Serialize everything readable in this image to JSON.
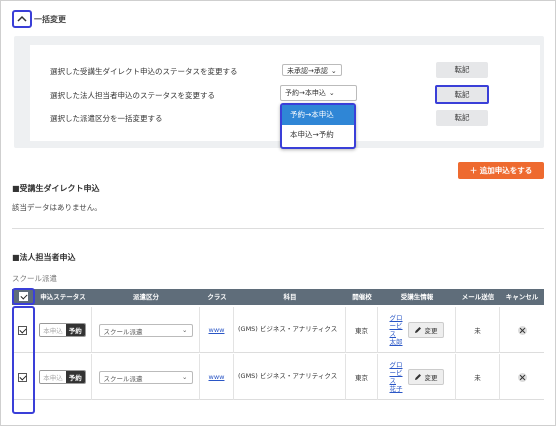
{
  "bulk": {
    "title": "一括変更",
    "rows": [
      {
        "label": "選択した受講生ダイレクト申込のステータスを変更する",
        "select_value": "未承認→承認",
        "button": "転記"
      },
      {
        "label": "選択した法人担当者申込のステータスを変更する",
        "select_value": "予約→本申込",
        "button": "転記"
      },
      {
        "label": "選択した派遣区分を一括変更する",
        "button": "転記"
      }
    ],
    "dropdown_options": [
      "予約→本申込",
      "本申込→予約"
    ]
  },
  "add_button": "＋ 追加申込をする",
  "direct": {
    "title": "■受講生ダイレクト申込",
    "empty_text": "該当データはありません。"
  },
  "corporate": {
    "title": "■法人担当者申込",
    "subtitle": "スクール派遣",
    "headers": [
      "",
      "申込ステータス",
      "派遣区分",
      "クラス",
      "科目",
      "開催校",
      "受講生情報",
      "メール送信",
      "キャンセル"
    ],
    "rows": [
      {
        "status_off": "本申込",
        "status_on": "予約",
        "dispatch": "スクール派遣",
        "class": "www",
        "subject": "(GMS) ビジネス・アナリティクス",
        "school": "東京",
        "student": "グロービス 太郎",
        "edit": "変更",
        "mail": "未"
      },
      {
        "status_off": "本申込",
        "status_on": "予約",
        "dispatch": "スクール派遣",
        "class": "www",
        "subject": "(GMS) ビジネス・アナリティクス",
        "school": "東京",
        "student": "グロービス 花子",
        "edit": "変更",
        "mail": "未"
      }
    ]
  },
  "colors": {
    "accent": "#3a3fd8",
    "add_button": "#ee6a2f",
    "table_header": "#5f6d7a",
    "dropdown_active": "#2f86d6"
  }
}
